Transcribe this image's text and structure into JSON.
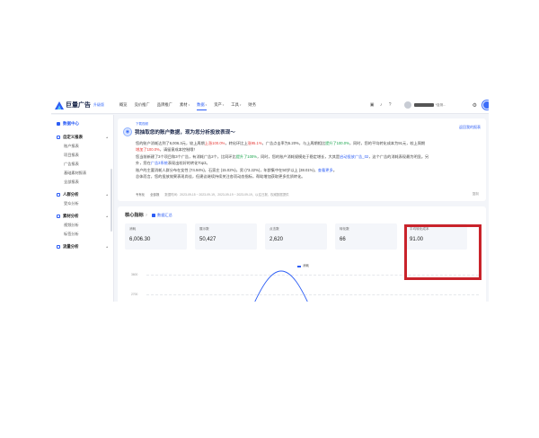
{
  "header": {
    "logo_text": "巨量广告",
    "edition": "升级版",
    "nav": [
      {
        "label": "概览",
        "chev": false,
        "active": false
      },
      {
        "label": "竞价推广",
        "chev": false,
        "active": false
      },
      {
        "label": "品牌推广",
        "chev": false,
        "active": false
      },
      {
        "label": "素材",
        "chev": true,
        "active": false
      },
      {
        "label": "数据",
        "chev": true,
        "active": true
      },
      {
        "label": "资产",
        "chev": true,
        "active": false
      },
      {
        "label": "工具",
        "chev": true,
        "active": false
      },
      {
        "label": "财务",
        "chev": false,
        "active": false
      }
    ],
    "user_extra": "*自测..."
  },
  "sidebar": {
    "top": "数据中心",
    "groups": [
      {
        "label": "自定义报表",
        "items": [
          "账户报表",
          "项目报表",
          "广告报表",
          "基础素材报表",
          "全部报表"
        ]
      },
      {
        "label": "人群分析",
        "items": [
          "受众分析"
        ]
      },
      {
        "label": "素材分析",
        "items": [
          "视频分析",
          "标签分析"
        ]
      },
      {
        "label": "流量分析",
        "items": []
      }
    ]
  },
  "ai": {
    "tag": "下载视频",
    "title": "我抽取您的账户数据，现为您分析投放表现～",
    "link": "返回我的报表",
    "lines": [
      {
        "parts": [
          [
            "n",
            "您的账户消耗达到了6,006.3元，较上周期"
          ],
          [
            "r",
            "上涨100.0%"
          ],
          [
            "n",
            "，转化环比上"
          ],
          [
            "r",
            "涨95.1%"
          ],
          [
            "n",
            "，广告点击率为5.20%，与上周期相比"
          ],
          [
            "g",
            "提升了100.0%"
          ],
          [
            "n",
            "，同时，您的平均转化成本为91元，较上周期"
          ]
        ]
      },
      {
        "cont": true,
        "parts": [
          [
            "r",
            "增加了100.0%"
          ],
          [
            "n",
            "，请留意成本控制哦！"
          ]
        ]
      },
      {
        "parts": [
          [
            "n",
            "您当前新建了3个项目和3个广告，有消耗广告2个，比同环比"
          ],
          [
            "g",
            "提升了100%"
          ],
          [
            "n",
            "，同时，您的账户消耗规模处于稳定增长，大其是"
          ],
          [
            "b",
            "启动投放广告_02"
          ],
          [
            "n",
            "，这个广告的消耗表现最为明显。另"
          ]
        ]
      },
      {
        "cont": true,
        "parts": [
          [
            "n",
            "外，您在"
          ],
          [
            "b",
            "广告3系统"
          ],
          [
            "n",
            "表现出较好的转化Top3。"
          ]
        ]
      },
      {
        "parts": [
          [
            "n",
            "账户的主要消耗人群分布在女性 (74.94%)，"
          ],
          [
            "n",
            "石家庄"
          ],
          [
            "n",
            " (15.02%)，"
          ],
          [
            "n",
            "男 (73.22%)，年龄集中在50岁以上 (38.01%)，"
          ],
          [
            "b",
            "查看更多"
          ],
          [
            "n",
            "。"
          ]
        ]
      },
      {
        "parts": [
          [
            "n",
            "总体而言，您的投放效果表现尚佳，但建议继续持续关注各项动态指标，帮助增加获取更多优质转化。"
          ]
        ]
      }
    ],
    "footer": [
      "专有化",
      "全部报",
      "数据时间：2023-09-15 ~ 2023-09-19，2023-09-19 ~ 2023-09-19，以往日报，权威数据提供"
    ],
    "footer_right": "复制"
  },
  "core": {
    "title": "核心指标",
    "help": "?",
    "option": "数据汇总",
    "cards": [
      {
        "label": "消耗",
        "value": "6,006.30"
      },
      {
        "label": "展示数",
        "value": "50,427"
      },
      {
        "label": "点击数",
        "value": "2,620"
      },
      {
        "label": "转化数",
        "value": "66"
      },
      {
        "label": "平均转化成本",
        "value": "91.00"
      }
    ],
    "legend": "消耗",
    "y_ticks": [
      "3600",
      "2700"
    ]
  },
  "colors": {
    "accent": "#2c5df5",
    "highlight_box": "#c9232b",
    "up_red": "#e53935",
    "up_green": "#16a34a"
  }
}
